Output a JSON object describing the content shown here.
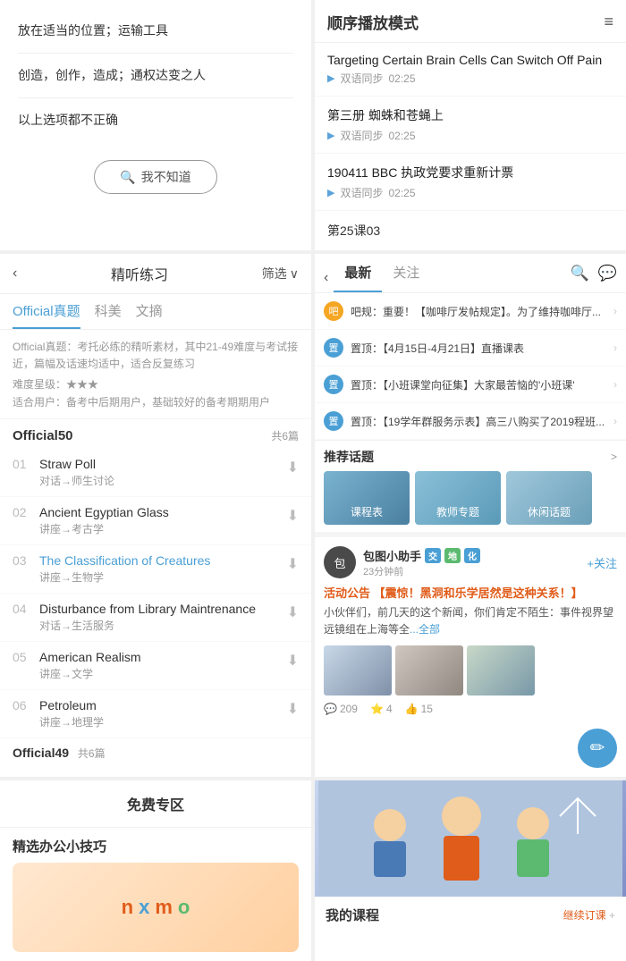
{
  "quiz": {
    "options": [
      "放在适当的位置；运输工具",
      "创造，创作，造成；通权达变之人",
      "以上选项都不正确"
    ],
    "unknown_btn": "我不知道"
  },
  "sequential": {
    "title": "顺序播放模式",
    "items": [
      {
        "title": "Targeting Certain Brain Cells Can Switch Off Pain",
        "tag": "双语同步",
        "duration": "02:25"
      },
      {
        "title": "第三册 蜘蛛和苍蝇上",
        "tag": "双语同步",
        "duration": "02:25"
      },
      {
        "title": "190411 BBC 执政党要求重新计票",
        "tag": "双语同步",
        "duration": "02:25"
      }
    ],
    "lesson_num": "第25课03"
  },
  "listen": {
    "title": "精听练习",
    "filter": "筛选",
    "tabs": [
      "Official真题",
      "科美",
      "文摘"
    ],
    "active_tab": 0,
    "description": "Official真题：考托必练的精听素材，其中21-49难度与考试接近，篇幅及话速均适中，适合反复练习",
    "difficulty": "难度星级：★★★",
    "target_users": "适合用户：备考中后期用户，基础较好的备考期期用户",
    "section": {
      "title": "Official50",
      "count": "共6篇",
      "tracks": [
        {
          "num": "01",
          "name": "Straw Poll",
          "type": "对话→师生讨论",
          "highlight": false
        },
        {
          "num": "02",
          "name": "Ancient Egyptian Glass",
          "type": "讲座→考古学",
          "highlight": false
        },
        {
          "num": "03",
          "name": "The Classification of Creatures",
          "type": "讲座→生物学",
          "highlight": true
        },
        {
          "num": "04",
          "name": "Disturbance from Library Maintrenance",
          "type": "对话→生活服务",
          "highlight": false
        },
        {
          "num": "05",
          "name": "American Realism",
          "type": "讲座→文学",
          "highlight": false
        },
        {
          "num": "06",
          "name": "Petroleum",
          "type": "讲座→地理学",
          "highlight": false
        }
      ]
    },
    "next_section": "Official49",
    "next_section_count": "共6篇"
  },
  "community": {
    "tabs": [
      "最新",
      "关注"
    ],
    "active_tab": 0,
    "notices": [
      {
        "icon_type": "orange",
        "icon_text": "吧",
        "text": "吧规：重要！【咖啡厅发帖规定】。为了维持咖啡厅..."
      },
      {
        "icon_type": "blue",
        "icon_text": "置",
        "text": "置顶：【4月15日-4月21日】直播课表"
      },
      {
        "icon_type": "blue",
        "icon_text": "置",
        "text": "置顶：【小班课堂向征集】大家最苦恼的'小班课'"
      },
      {
        "icon_type": "blue",
        "icon_text": "置",
        "text": "置顶：【19学年群服务示表】高三八购买了2019程班..."
      }
    ],
    "topics_section": {
      "title": "推荐话题",
      "more": ">",
      "topics": [
        "课程表",
        "教师专题",
        "休闲话题"
      ]
    },
    "post": {
      "author": "包图小助手",
      "badges": [
        "交",
        "地",
        "化"
      ],
      "time": "23分钟前",
      "follow_label": "+关注",
      "post_title": "活动公告 【震惊！黑洞和乐学居然是这种关系！】",
      "content": "小伙伴们，前几天的这个新闻，你们肯定不陌生：事件视界望远镜组在上海等全",
      "more_label": "...全部",
      "stats": {
        "comments": "209",
        "stars": "4",
        "likes": "15"
      }
    }
  },
  "free_zone": {
    "header": "免费专区",
    "section_title": "精选办公小技巧",
    "letters": [
      "n",
      "x",
      "m",
      "o"
    ]
  },
  "my_courses": {
    "title": "我的课程",
    "more_label": "继续订课",
    "subscribe_label": "继续订课 +"
  }
}
